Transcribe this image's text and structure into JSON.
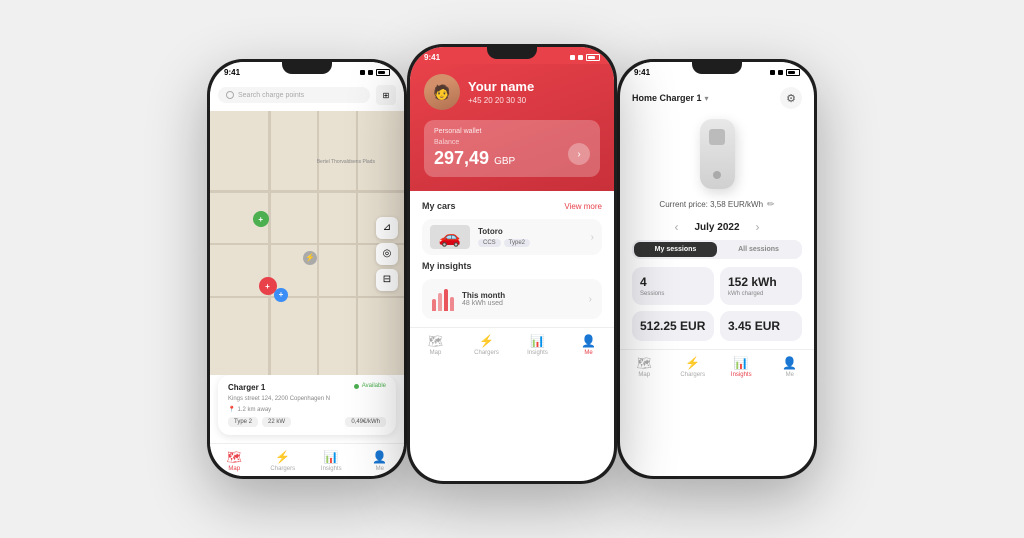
{
  "phones": {
    "left": {
      "time": "9:41",
      "search_placeholder": "Search charge points",
      "map_label": "Bertel Thorvaldsens Plads",
      "charger_name": "Charger 1",
      "charger_address": "Kings street 124, 2200 Copenhagen N",
      "charger_status": "Available",
      "charger_distance": "1.2 km away",
      "charger_type": "Type 2",
      "charger_power": "22 kW",
      "charger_price": "0,49€/kWh",
      "nav": [
        "Map",
        "Chargers",
        "Insights",
        "Me"
      ],
      "nav_active": "Map"
    },
    "middle": {
      "time": "9:41",
      "user_name": "Your name",
      "user_phone": "+45 20 20 30 30",
      "wallet_label": "Personal wallet",
      "balance_label": "Balance",
      "balance": "297,49",
      "currency": "GBP",
      "cars_section": "My cars",
      "view_more": "View more",
      "car_name": "Totoro",
      "car_tag1": "CCS",
      "car_tag2": "Type2",
      "insights_section": "My insights",
      "insights_period": "This month",
      "insights_kwh": "48 kWh used",
      "nav": [
        "Map",
        "Chargers",
        "Insights",
        "Me"
      ],
      "nav_active": "Me"
    },
    "right": {
      "time": "9:41",
      "charger_title": "Home Charger 1",
      "current_price": "Current price: 3,58 EUR/kWh",
      "month": "July 2022",
      "tab_my": "My sessions",
      "tab_all": "All sessions",
      "stat1_value": "4",
      "stat1_label": "Sessions",
      "stat2_value": "152 kWh",
      "stat2_label": "kWh charged",
      "stat3_value": "512.25 EUR",
      "stat3_label": "",
      "stat4_value": "3.45 EUR",
      "stat4_label": "",
      "nav": [
        "Map",
        "Chargers",
        "Insights",
        "Me"
      ],
      "nav_active": "Insights"
    }
  }
}
